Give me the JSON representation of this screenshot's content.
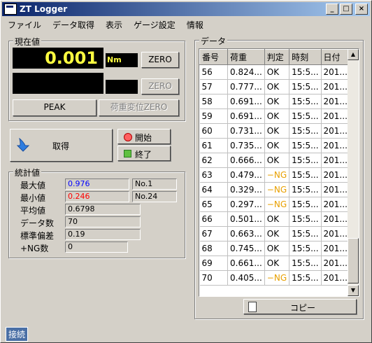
{
  "window": {
    "title": "ZT Logger",
    "buttons": {
      "minimize": "_",
      "maximize": "□",
      "close": "×"
    }
  },
  "menu": [
    "ファイル",
    "データ取得",
    "表示",
    "ゲージ設定",
    "情報"
  ],
  "current": {
    "title": "現在値",
    "value": "0.001",
    "unit": "Nm",
    "zero_label": "ZERO",
    "zero2_label": "ZERO",
    "peak_label": "PEAK",
    "load_reset_label": "荷重変位ZERO"
  },
  "acquire": {
    "label": "取得",
    "start_label": "開始",
    "end_label": "終了"
  },
  "stats": {
    "title": "統計値",
    "max_label": "最大値",
    "max_value": "0.976",
    "max_no": "No.1",
    "min_label": "最小値",
    "min_value": "0.246",
    "min_no": "No.24",
    "avg_label": "平均値",
    "avg_value": "0.6798",
    "count_label": "データ数",
    "count_value": "70",
    "std_label": "標準偏差",
    "std_value": "0.19",
    "ng_label": "+NG数",
    "ng_value": "0"
  },
  "data_panel": {
    "title": "データ",
    "columns": [
      "番号",
      "荷重",
      "判定",
      "時刻",
      "日付"
    ],
    "rows": [
      [
        "56",
        "0.824...",
        "OK",
        "15:5...",
        "201..."
      ],
      [
        "57",
        "0.777...",
        "OK",
        "15:5...",
        "201..."
      ],
      [
        "58",
        "0.691...",
        "OK",
        "15:5...",
        "201..."
      ],
      [
        "59",
        "0.691...",
        "OK",
        "15:5...",
        "201..."
      ],
      [
        "60",
        "0.731...",
        "OK",
        "15:5...",
        "201..."
      ],
      [
        "61",
        "0.735...",
        "OK",
        "15:5...",
        "201..."
      ],
      [
        "62",
        "0.666...",
        "OK",
        "15:5...",
        "201..."
      ],
      [
        "63",
        "0.479...",
        "−NG",
        "15:5...",
        "201..."
      ],
      [
        "64",
        "0.329...",
        "−NG",
        "15:5...",
        "201..."
      ],
      [
        "65",
        "0.297...",
        "−NG",
        "15:5...",
        "201..."
      ],
      [
        "66",
        "0.501...",
        "OK",
        "15:5...",
        "201..."
      ],
      [
        "67",
        "0.663...",
        "OK",
        "15:5...",
        "201..."
      ],
      [
        "68",
        "0.745...",
        "OK",
        "15:5...",
        "201..."
      ],
      [
        "69",
        "0.661...",
        "OK",
        "15:5...",
        "201..."
      ],
      [
        "70",
        "0.405...",
        "−NG",
        "15:5...",
        "201..."
      ]
    ],
    "copy_label": "コピー"
  },
  "status": {
    "connection": "接続"
  },
  "colors": {
    "max_value": "#0000ff",
    "min_value": "#ff0000",
    "value_display": "#ffff40",
    "ng": "#e8a000"
  }
}
